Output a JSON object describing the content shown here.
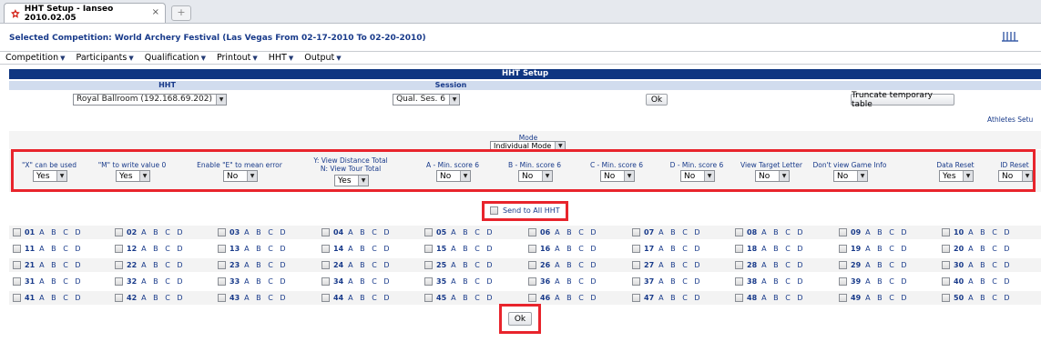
{
  "browser": {
    "tab_title": "HHT Setup - Ianseo 2010.02.05",
    "tab_close": "×",
    "new_tab": "+"
  },
  "header": {
    "competition_line": "Selected Competition: World Archery Festival (Las Vegas From 02-17-2010 To 02-20-2010)"
  },
  "menu": [
    {
      "label": "Competition"
    },
    {
      "label": "Participants"
    },
    {
      "label": "Qualification"
    },
    {
      "label": "Printout"
    },
    {
      "label": "HHT"
    },
    {
      "label": "Output"
    }
  ],
  "setup": {
    "title": "HHT Setup",
    "hht_header": "HHT",
    "session_header": "Session",
    "hht_value": "Royal Ballroom (192.168.69.202)",
    "session_value": "Qual. Ses. 6",
    "ok_label": "Ok",
    "truncate_label": "Truncate temporary table",
    "athletes_link": "Athletes Setu",
    "mode_label": "Mode",
    "mode_value": "Individual Mode"
  },
  "options": [
    {
      "label": "\"X\" can be used",
      "value": "Yes"
    },
    {
      "label": "\"M\" to write value 0",
      "value": "Yes"
    },
    {
      "label": "Enable \"E\" to mean error",
      "value": "No"
    },
    {
      "label": "Y: View Distance Total\nN: View Tour Total",
      "value": "Yes"
    },
    {
      "label": "A - Min. score 6",
      "value": "No"
    },
    {
      "label": "B - Min. score 6",
      "value": "No"
    },
    {
      "label": "C - Min. score 6",
      "value": "No"
    },
    {
      "label": "D - Min. score 6",
      "value": "No"
    },
    {
      "label": "View Target Letter",
      "value": "No"
    },
    {
      "label": "Don't view Game Info",
      "value": "No"
    },
    {
      "label": "Data Reset",
      "value": "Yes"
    },
    {
      "label": "ID Reset",
      "value": "No"
    }
  ],
  "send_all": {
    "label": "Send to All HHT"
  },
  "targets": {
    "letters": "A B C D",
    "numbers": [
      "01",
      "02",
      "03",
      "04",
      "05",
      "06",
      "07",
      "08",
      "09",
      "10",
      "11",
      "12",
      "13",
      "14",
      "15",
      "16",
      "17",
      "18",
      "19",
      "20",
      "21",
      "22",
      "23",
      "24",
      "25",
      "26",
      "27",
      "28",
      "29",
      "30",
      "31",
      "32",
      "33",
      "34",
      "35",
      "36",
      "37",
      "38",
      "39",
      "40",
      "41",
      "42",
      "43",
      "44",
      "45",
      "46",
      "47",
      "48",
      "49",
      "50"
    ]
  },
  "footer": {
    "ok_label": "Ok"
  },
  "colors": {
    "header_bg": "#0f3681",
    "subheader_bg": "#d1dcee",
    "link": "#183a8a",
    "highlight": "#e8242c"
  }
}
